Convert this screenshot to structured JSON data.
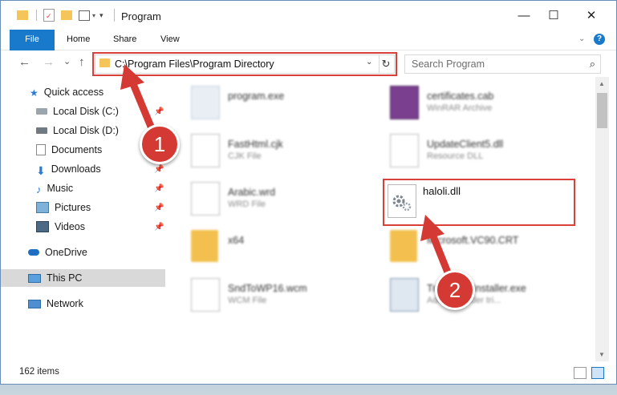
{
  "window": {
    "title": "Program",
    "caption": {
      "minimize": "—",
      "maximize": "☐",
      "close": "✕"
    }
  },
  "ribbon": {
    "tabs": [
      "File",
      "Home",
      "Share",
      "View"
    ],
    "help_label": "?"
  },
  "navigation": {
    "back": "←",
    "forward": "→",
    "recent": "⌄",
    "up": "↑",
    "address": "C:\\Program Files\\Program Directory",
    "refresh": "↻",
    "search_placeholder": "Search Program",
    "search_icon": "⌕"
  },
  "sidebar": {
    "items": [
      {
        "label": "Quick access",
        "icon": "star-icon"
      },
      {
        "label": "Local Disk (C:)",
        "icon": "drive-icon"
      },
      {
        "label": "Local Disk (D:)",
        "icon": "drive-icon"
      },
      {
        "label": "Documents",
        "icon": "documents-icon"
      },
      {
        "label": "Downloads",
        "icon": "download-icon"
      },
      {
        "label": "Music",
        "icon": "music-icon"
      },
      {
        "label": "Pictures",
        "icon": "pictures-icon"
      },
      {
        "label": "Videos",
        "icon": "videos-icon"
      },
      {
        "label": "OneDrive",
        "icon": "cloud-icon"
      },
      {
        "label": "This PC",
        "icon": "computer-icon"
      },
      {
        "label": "Network",
        "icon": "network-icon"
      }
    ],
    "pin": "📌"
  },
  "files": [
    {
      "name": "program.exe",
      "type": ""
    },
    {
      "name": "certificates.cab",
      "type": "WinRAR Archive"
    },
    {
      "name": "FastHtml.cjk",
      "type": "CJK File"
    },
    {
      "name": "UpdateClient5.dll",
      "type": "Resource DLL"
    },
    {
      "name": "Arabic.wrd",
      "type": "WRD File"
    },
    {
      "name": "haloli.dll",
      "type": ""
    },
    {
      "name": "x64",
      "type": ""
    },
    {
      "name": "Microsoft.VC90.CRT",
      "type": ""
    },
    {
      "name": "SndToWP16.wcm",
      "type": "WCM File"
    },
    {
      "name": "TransmissInstaller.exe",
      "type": "Adobe Reader tri..."
    }
  ],
  "status": {
    "count": "162 items"
  },
  "annotations": {
    "step1": "1",
    "step2": "2"
  },
  "colors": {
    "accent": "#1979ca",
    "annotation": "#d9403a"
  }
}
